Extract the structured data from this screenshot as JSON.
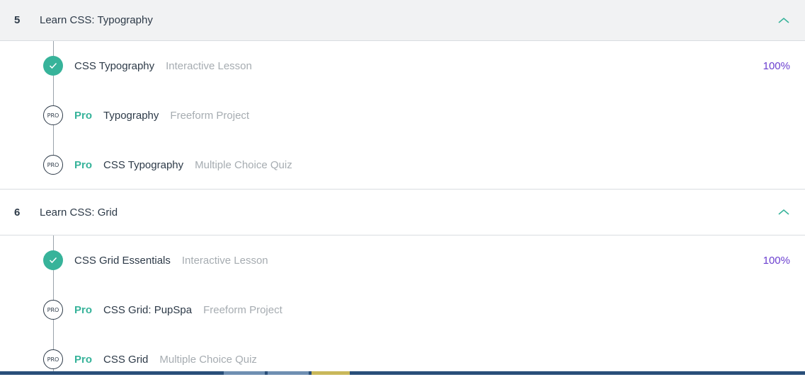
{
  "modules": [
    {
      "number": "5",
      "title": "Learn CSS: Typography",
      "items": [
        {
          "status": "complete",
          "pro": "",
          "name": "CSS Typography",
          "type": "Interactive Lesson",
          "progress": "100%"
        },
        {
          "status": "pro",
          "pro": "Pro",
          "name": "Typography",
          "type": "Freeform Project",
          "progress": ""
        },
        {
          "status": "pro",
          "pro": "Pro",
          "name": "CSS Typography",
          "type": "Multiple Choice Quiz",
          "progress": ""
        }
      ]
    },
    {
      "number": "6",
      "title": "Learn CSS: Grid",
      "items": [
        {
          "status": "complete",
          "pro": "",
          "name": "CSS Grid Essentials",
          "type": "Interactive Lesson",
          "progress": "100%"
        },
        {
          "status": "pro",
          "pro": "Pro",
          "name": "CSS Grid: PupSpa",
          "type": "Freeform Project",
          "progress": ""
        },
        {
          "status": "pro",
          "pro": "Pro",
          "name": "CSS Grid",
          "type": "Multiple Choice Quiz",
          "progress": ""
        }
      ]
    }
  ],
  "badge_text": "PRO",
  "icons": {
    "collapse": "chevron-up-icon",
    "complete": "checkmark-icon"
  },
  "colors": {
    "accent_green": "#37b39a",
    "progress_purple": "#6b3fd0",
    "text_dark": "#2d3a48",
    "text_muted": "#a6acb1"
  }
}
